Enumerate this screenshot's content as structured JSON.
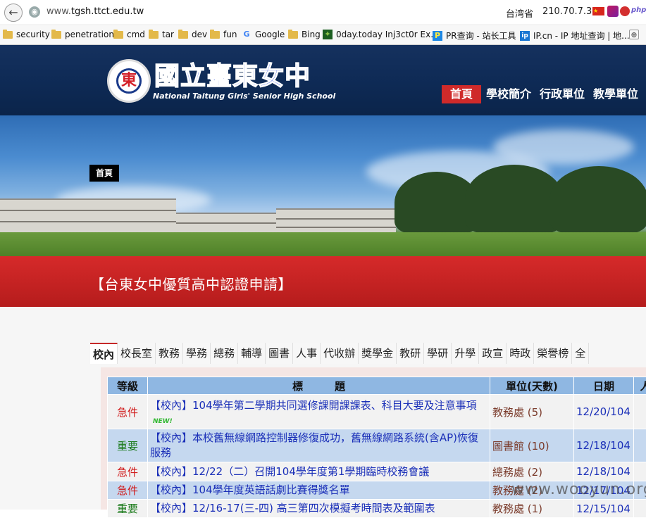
{
  "browser": {
    "url_prefix": "www.",
    "url_host": "tgsh.ttct.edu.tw",
    "geo_location": "台湾省",
    "ip_address": "210.70.7.3",
    "bookmarks": [
      {
        "label": "security",
        "icon": "folder-icon"
      },
      {
        "label": "penetration",
        "icon": "folder-icon"
      },
      {
        "label": "cmd",
        "icon": "folder-icon"
      },
      {
        "label": "tar",
        "icon": "folder-icon"
      },
      {
        "label": "dev",
        "icon": "folder-icon"
      },
      {
        "label": "fun",
        "icon": "folder-icon"
      },
      {
        "label": "Google",
        "icon": "google-icon"
      },
      {
        "label": "Bing",
        "icon": "folder-icon"
      },
      {
        "label": "0day.today Inj3ct0r Ex...",
        "icon": "exploit-icon"
      },
      {
        "label": "PR查询 - 站长工具",
        "icon": "pr-icon"
      },
      {
        "label": "IP.cn - IP 地址查询 | 地...",
        "icon": "ip-icon"
      }
    ]
  },
  "site": {
    "school_name": "國立臺東女中",
    "school_name_en": "National Taitung Girls' Senior High School",
    "logo_glyph": "東",
    "nav": [
      "首頁",
      "學校簡介",
      "行政單位",
      "教學單位"
    ],
    "breadcrumb": "首頁",
    "banner_title": "【台東女中優質高中認證申請】"
  },
  "tabs": [
    "校內",
    "校長室",
    "教務",
    "學務",
    "總務",
    "輔導",
    "圖書",
    "人事",
    "代收辦",
    "獎學金",
    "教研",
    "學研",
    "升學",
    "政宣",
    "時政",
    "榮譽榜",
    "全"
  ],
  "table": {
    "headers": [
      "等級",
      "標　　　題",
      "單位(天數)",
      "日期",
      "人"
    ],
    "rows": [
      {
        "level": "急件",
        "level_type": "urgent",
        "title": "【校內】104學年第二學期共同選修課開課課表、科目大要及注意事項",
        "new": "NEW!",
        "unit": "教務處 (5)",
        "date": "12/20/104"
      },
      {
        "level": "重要",
        "level_type": "important",
        "title": "【校內】本校舊無線網路控制器修復成功，舊無線網路系統(含AP)恢復服務",
        "new": "",
        "unit": "圖書館 (10)",
        "date": "12/18/104"
      },
      {
        "level": "急件",
        "level_type": "urgent",
        "title": "【校內】12/22（二）召開104學年度第1學期臨時校務會議",
        "new": "",
        "unit": "總務處 (2)",
        "date": "12/18/104"
      },
      {
        "level": "急件",
        "level_type": "urgent",
        "title": "【校內】104學年度英語話劇比賽得獎名單",
        "new": "",
        "unit": "教務處 (2)",
        "date": "12/17/104"
      },
      {
        "level": "重要",
        "level_type": "important",
        "title": "【校內】12/16-17(三-四) 高三第四次模擬考時間表及範圍表",
        "new": "",
        "unit": "教務處 (1)",
        "date": "12/15/104"
      }
    ]
  },
  "watermark": "www.wooyun.org",
  "colors": {
    "header_bg": "#0e2a55",
    "banner_red": "#c62828",
    "table_header": "#8fb7e2",
    "urgent": "#d01919",
    "important": "#1a7a1a"
  }
}
